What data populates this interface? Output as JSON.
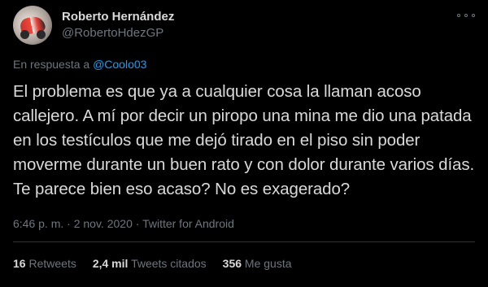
{
  "author": {
    "display_name": "Roberto Hernández",
    "handle": "@RobertoHdezGP",
    "avatar_icon": "motorcycle-avatar"
  },
  "reply": {
    "prefix": "En respuesta a",
    "mention": "@Coolo03"
  },
  "tweet": {
    "text": "El problema es que ya a cualquier cosa la llaman acoso callejero. A mí por decir un piropo una mina me dio una patada en los testículos que me dejó tirado en el piso sin poder moverme durante un buen rato y con dolor durante varios días. Te parece bien eso acaso? No es exagerado?"
  },
  "meta": {
    "time": "6:46 p. m.",
    "date": "2 nov. 2020",
    "source": "Twitter for Android",
    "separator": "·"
  },
  "stats": [
    {
      "value": "16",
      "label": "Retweets"
    },
    {
      "value": "2,4 mil",
      "label": "Tweets citados"
    },
    {
      "value": "356",
      "label": "Me gusta"
    }
  ],
  "colors": {
    "background": "#000000",
    "text": "#d9d9d9",
    "muted": "#6e767d",
    "link": "#1d9bf0",
    "divider": "#2f3336"
  }
}
